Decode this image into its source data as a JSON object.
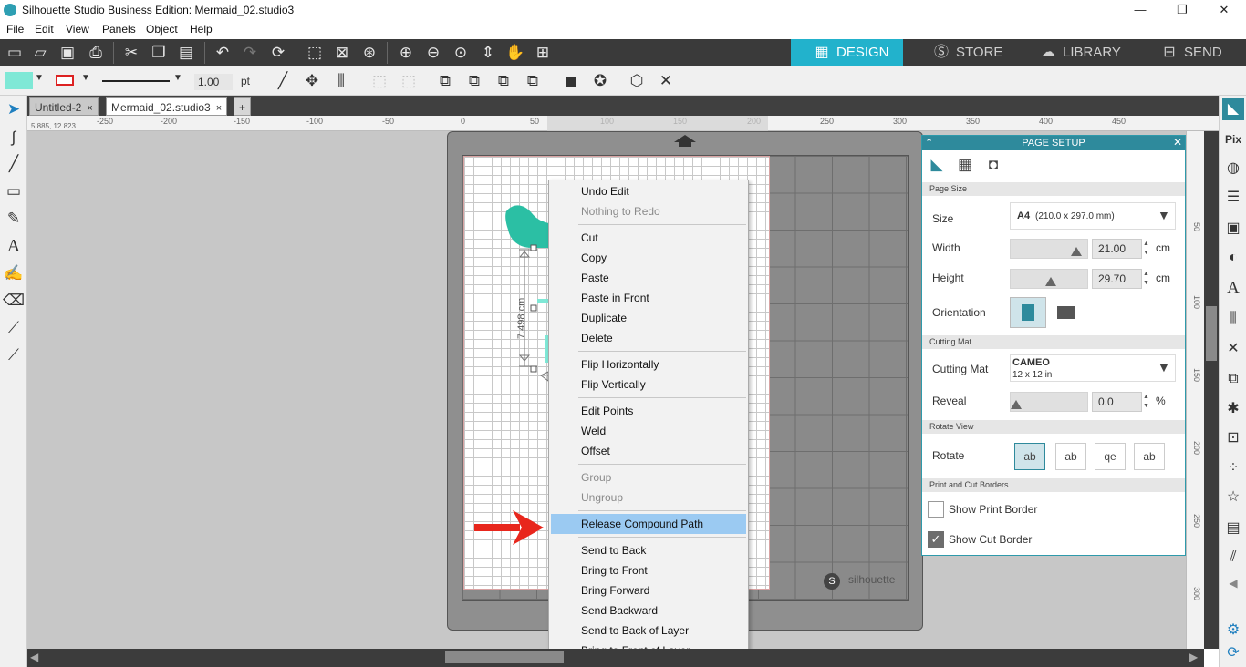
{
  "window": {
    "title": "Silhouette Studio Business Edition: Mermaid_02.studio3",
    "minimize": "—",
    "maximize": "❐",
    "close": "✕"
  },
  "menu": [
    "File",
    "Edit",
    "View",
    "Panels",
    "Object",
    "Help"
  ],
  "mode_tabs": {
    "design": "DESIGN",
    "store": "STORE",
    "library": "LIBRARY",
    "send": "SEND"
  },
  "line_style": {
    "weight": "1.00",
    "unit": "pt"
  },
  "doc_tabs": [
    {
      "label": "Untitled-2",
      "close": "×"
    },
    {
      "label": "Mermaid_02.studio3",
      "close": "×"
    }
  ],
  "new_tab": "+",
  "coord_readout": "5.885, 12.823",
  "ruler_h": [
    "-250",
    "-200",
    "-150",
    "-100",
    "-50",
    "0",
    "50",
    "100",
    "150",
    "200",
    "250",
    "300",
    "350",
    "400",
    "450"
  ],
  "ruler_v": [
    "50",
    "100",
    "150",
    "200",
    "250",
    "300"
  ],
  "dimension_label": "7.498 cm",
  "mat_logo": "silhouette",
  "context_menu": [
    {
      "label": "Undo Edit",
      "enabled": true
    },
    {
      "label": "Nothing to Redo",
      "enabled": false
    },
    {
      "label": "Cut",
      "enabled": true
    },
    {
      "label": "Copy",
      "enabled": true
    },
    {
      "label": "Paste",
      "enabled": true
    },
    {
      "label": "Paste in Front",
      "enabled": true
    },
    {
      "label": "Duplicate",
      "enabled": true
    },
    {
      "label": "Delete",
      "enabled": true
    },
    {
      "label": "Flip Horizontally",
      "enabled": true
    },
    {
      "label": "Flip Vertically",
      "enabled": true
    },
    {
      "label": "Edit Points",
      "enabled": true
    },
    {
      "label": "Weld",
      "enabled": true
    },
    {
      "label": "Offset",
      "enabled": true
    },
    {
      "label": "Group",
      "enabled": false
    },
    {
      "label": "Ungroup",
      "enabled": false
    },
    {
      "label": "Release Compound Path",
      "enabled": true,
      "highlighted": true
    },
    {
      "label": "Send to Back",
      "enabled": true
    },
    {
      "label": "Bring to Front",
      "enabled": true
    },
    {
      "label": "Bring Forward",
      "enabled": true
    },
    {
      "label": "Send Backward",
      "enabled": true
    },
    {
      "label": "Send to Back of Layer",
      "enabled": true
    },
    {
      "label": "Bring to Front of Layer",
      "enabled": true
    }
  ],
  "page_setup": {
    "title": "PAGE SETUP",
    "close": "✕",
    "sections": {
      "page_size": "Page Size",
      "cutting_mat": "Cutting Mat",
      "rotate_view": "Rotate View",
      "borders": "Print and Cut Borders"
    },
    "size": {
      "label": "Size",
      "value": "A4",
      "detail": "(210.0 x 297.0 mm)"
    },
    "width": {
      "label": "Width",
      "value": "21.00",
      "unit": "cm"
    },
    "height": {
      "label": "Height",
      "value": "29.70",
      "unit": "cm"
    },
    "orientation": {
      "label": "Orientation"
    },
    "mat": {
      "label": "Cutting Mat",
      "value": "CAMEO",
      "detail": "12 x 12 in"
    },
    "reveal": {
      "label": "Reveal",
      "value": "0.0",
      "unit": "%"
    },
    "rotate": {
      "label": "Rotate",
      "options": [
        "ab",
        "ab",
        "qe",
        "ab"
      ]
    },
    "show_print_border": {
      "label": "Show Print Border",
      "checked": false
    },
    "show_cut_border": {
      "label": "Show Cut Border",
      "checked": true
    }
  },
  "colors": {
    "accent": "#22b2cc",
    "fill_swatch": "#7fe8d6",
    "mermaid_tail": "#2bbfa4",
    "highlight": "#9bcaf2",
    "arrow": "#e8261c"
  }
}
